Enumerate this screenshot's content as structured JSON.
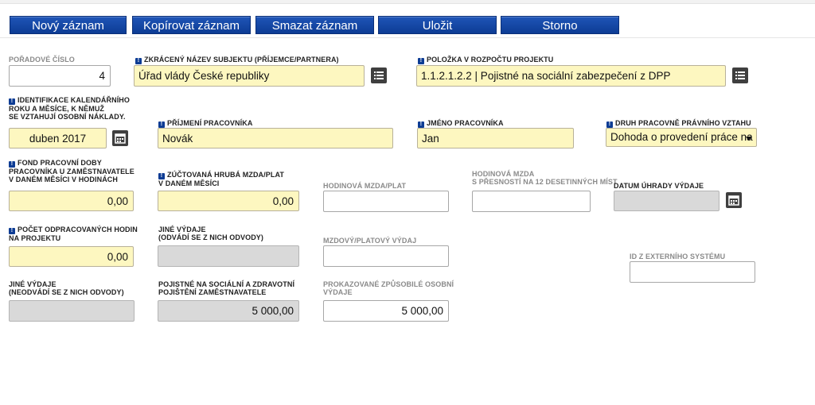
{
  "toolbar": {
    "new": "Nový záznam",
    "copy": "Kopírovat záznam",
    "delete": "Smazat záznam",
    "save": "Uložit",
    "cancel": "Storno"
  },
  "fields": {
    "order_number": {
      "label": "POŘADOVÉ ČÍSLO",
      "value": "4"
    },
    "subject_short_name": {
      "label": "ZKRÁCENÝ NÁZEV SUBJEKTU (PŘÍJEMCE/PARTNERA)",
      "value": "Úřad vlády České republiky"
    },
    "budget_item": {
      "label": "POLOŽKA V ROZPOČTU PROJEKTU",
      "value": "1.1.2.1.2.2 | Pojistné na sociální zabezpečení z DPP"
    },
    "period": {
      "label_lines": [
        "IDENTIFIKACE KALENDÁŘNÍHO",
        "ROKU A MĚSÍCE, K NĚMUŽ",
        "SE VZTAHUJÍ OSOBNÍ NÁKLADY."
      ],
      "value": "duben 2017"
    },
    "surname": {
      "label": "PŘÍJMENÍ PRACOVNÍKA",
      "value": "Novák"
    },
    "first_name": {
      "label": "JMÉNO PRACOVNÍKA",
      "value": "Jan"
    },
    "employment_type": {
      "label": "DRUH PRACOVNĚ PRÁVNÍHO VZTAHU",
      "value": "Dohoda o provedení práce na"
    },
    "work_fund": {
      "label_lines": [
        "FOND PRACOVNÍ DOBY",
        "PRACOVNÍKA U ZAMĚSTNAVATELE",
        "V DANÉM MĚSÍCI V HODINÁCH"
      ],
      "value": "0,00"
    },
    "gross_wage": {
      "label_lines": [
        "ZÚČTOVANÁ HRUBÁ MZDA/PLAT",
        "V DANÉM MĚSÍCI"
      ],
      "value": "0,00"
    },
    "hourly_wage": {
      "label": "HODINOVÁ MZDA/PLAT",
      "value": ""
    },
    "hourly_wage_precise": {
      "label_lines": [
        "HODINOVÁ MZDA",
        "S PŘESNOSTÍ NA 12 DESETINNÝCH MÍST"
      ],
      "value": ""
    },
    "payment_date": {
      "label": "DATUM ÚHRADY VÝDAJE",
      "value": ""
    },
    "hours_worked": {
      "label_lines": [
        "POČET ODPRACOVANÝCH HODIN",
        "NA PROJEKTU"
      ],
      "value": "0,00"
    },
    "other_expenses_taxed": {
      "label_lines": [
        "JINÉ VÝDAJE",
        "(ODVÁDÍ SE Z NICH ODVODY)"
      ],
      "value": ""
    },
    "wage_expense": {
      "label": "MZDOVÝ/PLATOVÝ VÝDAJ",
      "value": ""
    },
    "external_id": {
      "label": "ID Z EXTERNÍHO SYSTÉMU",
      "value": ""
    },
    "other_expenses_untaxed": {
      "label_lines": [
        "JINÉ VÝDAJE",
        "(NEODVÁDÍ SE Z NICH ODVODY)"
      ],
      "value": ""
    },
    "insurance": {
      "label_lines": [
        "POJISTNÉ NA SOCIÁLNÍ A ZDRAVOTNÍ",
        "POJIŠTĚNÍ ZAMĚSTNAVATELE"
      ],
      "value": "5 000,00"
    },
    "eligible_expenses": {
      "label_lines": [
        "PROKAZOVANÉ ZPŮSOBILÉ OSOBNÍ",
        "VÝDAJE"
      ],
      "value": "5 000,00"
    }
  },
  "icons": {
    "required": "required-icon",
    "list": "list-icon",
    "calendar": "calendar-icon",
    "dropdown": "chevron-down-icon"
  },
  "colors": {
    "button": "#0d3c94",
    "required_field": "#fdf7c0",
    "readonly_field": "#d9d9d9"
  }
}
